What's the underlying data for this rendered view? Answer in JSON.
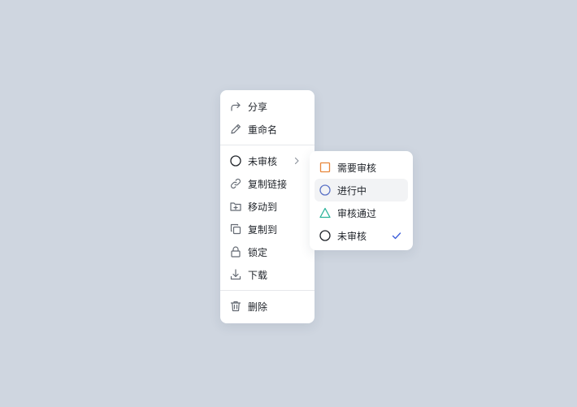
{
  "menu": {
    "share": {
      "label": "分享",
      "icon": "share-icon"
    },
    "rename": {
      "label": "重命名",
      "icon": "pencil-icon"
    },
    "status": {
      "label": "未审核",
      "icon": "circle-icon"
    },
    "copy_link": {
      "label": "复制链接",
      "icon": "link-icon"
    },
    "move_to": {
      "label": "移动到",
      "icon": "folder-move-icon"
    },
    "copy_to": {
      "label": "复制到",
      "icon": "copy-icon"
    },
    "lock": {
      "label": "锁定",
      "icon": "lock-icon"
    },
    "download": {
      "label": "下载",
      "icon": "download-icon"
    },
    "delete": {
      "label": "删除",
      "icon": "trash-icon"
    }
  },
  "submenu": {
    "items": [
      {
        "label": "需要审核",
        "icon": "square-icon",
        "color": "#e8863a"
      },
      {
        "label": "进行中",
        "icon": "circle-icon",
        "color": "#5b72c6"
      },
      {
        "label": "审核通过",
        "icon": "triangle-icon",
        "color": "#2bb39a"
      },
      {
        "label": "未审核",
        "icon": "circle-icon",
        "color": "#1f2329",
        "selected": true
      }
    ],
    "check_color": "#3a5bd9"
  }
}
